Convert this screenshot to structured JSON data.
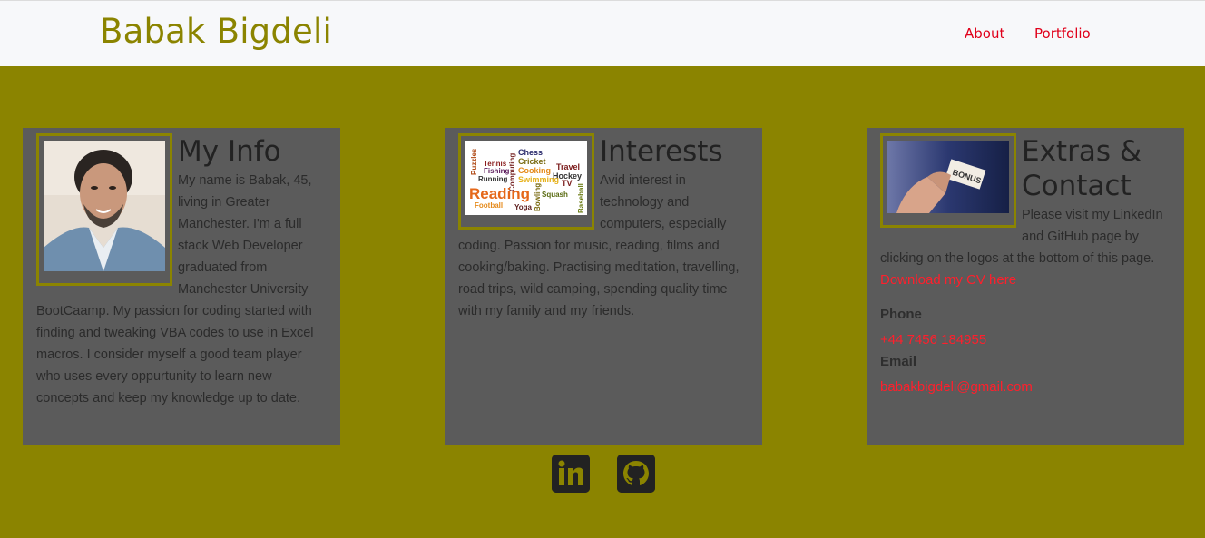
{
  "brand": "Babak Bigdeli",
  "nav": {
    "about": "About",
    "portfolio": "Portfolio"
  },
  "cards": [
    {
      "title": "My Info",
      "text": "My name is Babak, 45, living in Greater Manchester. I'm a full stack Web Developer graduated from Manchester University BootCaamp. My passion for coding started with finding and tweaking VBA codes to use in Excel macros. I consider myself a good team player who uses every oppurtunity to learn new concepts and keep my knowledge up to date.",
      "image": "profile-photo"
    },
    {
      "title": "Interests",
      "text": "Avid interest in technology and computers, especially coding. Passion for music, reading, films and cooking/baking. Practising meditation, travelling, road trips, wild camping, spending quality time with my family and my friends.",
      "image": "interests-wordcloud",
      "cloud_words": [
        "Puzzles",
        "Chess",
        "Cricket",
        "Tennis",
        "Fishing",
        "Computing",
        "Cooking",
        "Travel",
        "Running",
        "Hockey",
        "Swimming",
        "TV",
        "Reading",
        "Squash",
        "Football",
        "Yoga",
        "Bowling",
        "Baseball"
      ]
    },
    {
      "title": "Extras & Contact",
      "text": "Please visit my LinkedIn and GitHub page by clicking on the logos at the bottom of this page.",
      "image": "bonus-card-photo",
      "image_text": "BONUS",
      "cv_link": "Download my CV here",
      "phone_label": "Phone",
      "phone": "+44 7456 184955",
      "email_label": "Email",
      "email": "babakbigdeli@gmail.com"
    }
  ],
  "social": {
    "linkedin": "linkedin-icon",
    "github": "github-icon"
  },
  "colors": {
    "olive": "#8b8400",
    "card": "#5b5b5b",
    "link": "#e0001a"
  }
}
